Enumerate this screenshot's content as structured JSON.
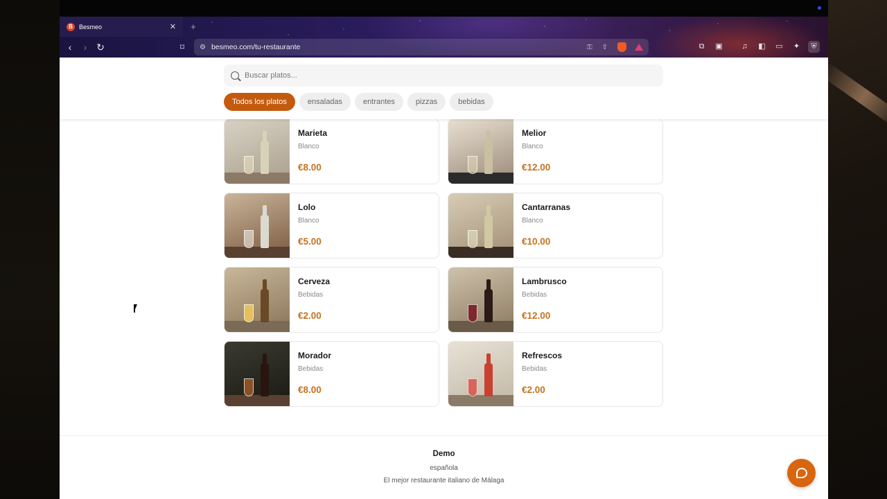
{
  "browser": {
    "tab": {
      "title": "Besmeo",
      "favicon": "B"
    },
    "url": "besmeo.com/tu-restaurante"
  },
  "search": {
    "placeholder": "Buscar platos..."
  },
  "categories": [
    {
      "label": "Todos los platos",
      "active": true
    },
    {
      "label": "ensaladas",
      "active": false
    },
    {
      "label": "entrantes",
      "active": false
    },
    {
      "label": "pizzas",
      "active": false
    },
    {
      "label": "bebidas",
      "active": false
    }
  ],
  "dishes": [
    {
      "name": "Marieta",
      "category": "Blanco",
      "price": "€8.00"
    },
    {
      "name": "Melior",
      "category": "Blanco",
      "price": "€12.00"
    },
    {
      "name": "Lolo",
      "category": "Blanco",
      "price": "€5.00"
    },
    {
      "name": "Cantarranas",
      "category": "Blanco",
      "price": "€10.00"
    },
    {
      "name": "Cerveza",
      "category": "Bebidas",
      "price": "€2.00"
    },
    {
      "name": "Lambrusco",
      "category": "Bebidas",
      "price": "€12.00"
    },
    {
      "name": "Morador",
      "category": "Bebidas",
      "price": "€8.00"
    },
    {
      "name": "Refrescos",
      "category": "Bebidas",
      "price": "€2.00"
    }
  ],
  "footer": {
    "title": "Demo",
    "cuisine": "española",
    "tagline": "El mejor restaurante italiano de Málaga"
  },
  "colors": {
    "accent": "#c35a0e",
    "price": "#c7711c",
    "chat": "#d9650f"
  }
}
